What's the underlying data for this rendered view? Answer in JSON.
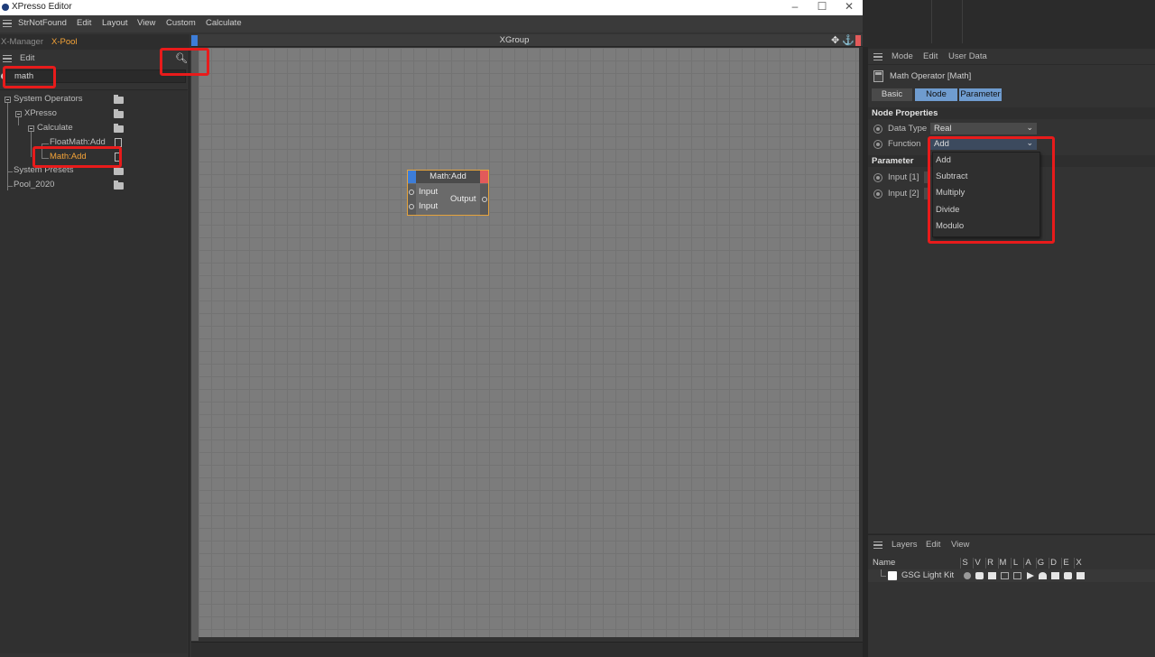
{
  "window": {
    "title": "XPresso Editor",
    "minimize_glyph": "–",
    "maximize_glyph": "☐",
    "close_glyph": "✕"
  },
  "menubar": {
    "items": [
      "StrNotFound",
      "Edit",
      "Layout",
      "View",
      "Custom",
      "Calculate"
    ]
  },
  "pool": {
    "tabs": [
      "X-Manager",
      "X-Pool"
    ],
    "edit_label": "Edit",
    "search_icon": "search-icon",
    "search_value": "math",
    "tree": [
      {
        "label": "System Operators"
      },
      {
        "label": "XPresso"
      },
      {
        "label": "Calculate"
      },
      {
        "label": "FloatMath:Add"
      },
      {
        "label": "Math:Add"
      },
      {
        "label": "System Presets"
      },
      {
        "label": "Pool_2020"
      }
    ]
  },
  "canvas": {
    "title": "XGroup",
    "move_glyph": "✥",
    "anchor_glyph": "⚓"
  },
  "node": {
    "title": "Math:Add",
    "inputs": [
      "Input",
      "Input"
    ],
    "output": "Output",
    "border_color": "#e5a33d"
  },
  "attributes": {
    "menu": [
      "Mode",
      "Edit",
      "User Data"
    ],
    "title": "Math Operator [Math]",
    "tabs": [
      "Basic",
      "Node",
      "Parameter"
    ],
    "node_properties_heading": "Node Properties",
    "data_type_label": "Data Type",
    "data_type_value": "Real",
    "function_label": "Function",
    "function_value": "Add",
    "parameter_heading": "Parameter",
    "input1_label": "Input [1]",
    "input2_label": "Input [2]",
    "function_options": [
      "Add",
      "Subtract",
      "Multiply",
      "Divide",
      "Modulo"
    ]
  },
  "layers": {
    "menu": [
      "Layers",
      "Edit",
      "View"
    ],
    "name_header": "Name",
    "columns": [
      "S",
      "V",
      "R",
      "M",
      "L",
      "A",
      "G",
      "D",
      "E",
      "X"
    ],
    "row_name": "GSG Light Kit"
  },
  "colors": {
    "highlight_red": "#e81b1b",
    "pool_highlight": "#f4a338",
    "active_tab": "#6f9ccf"
  }
}
